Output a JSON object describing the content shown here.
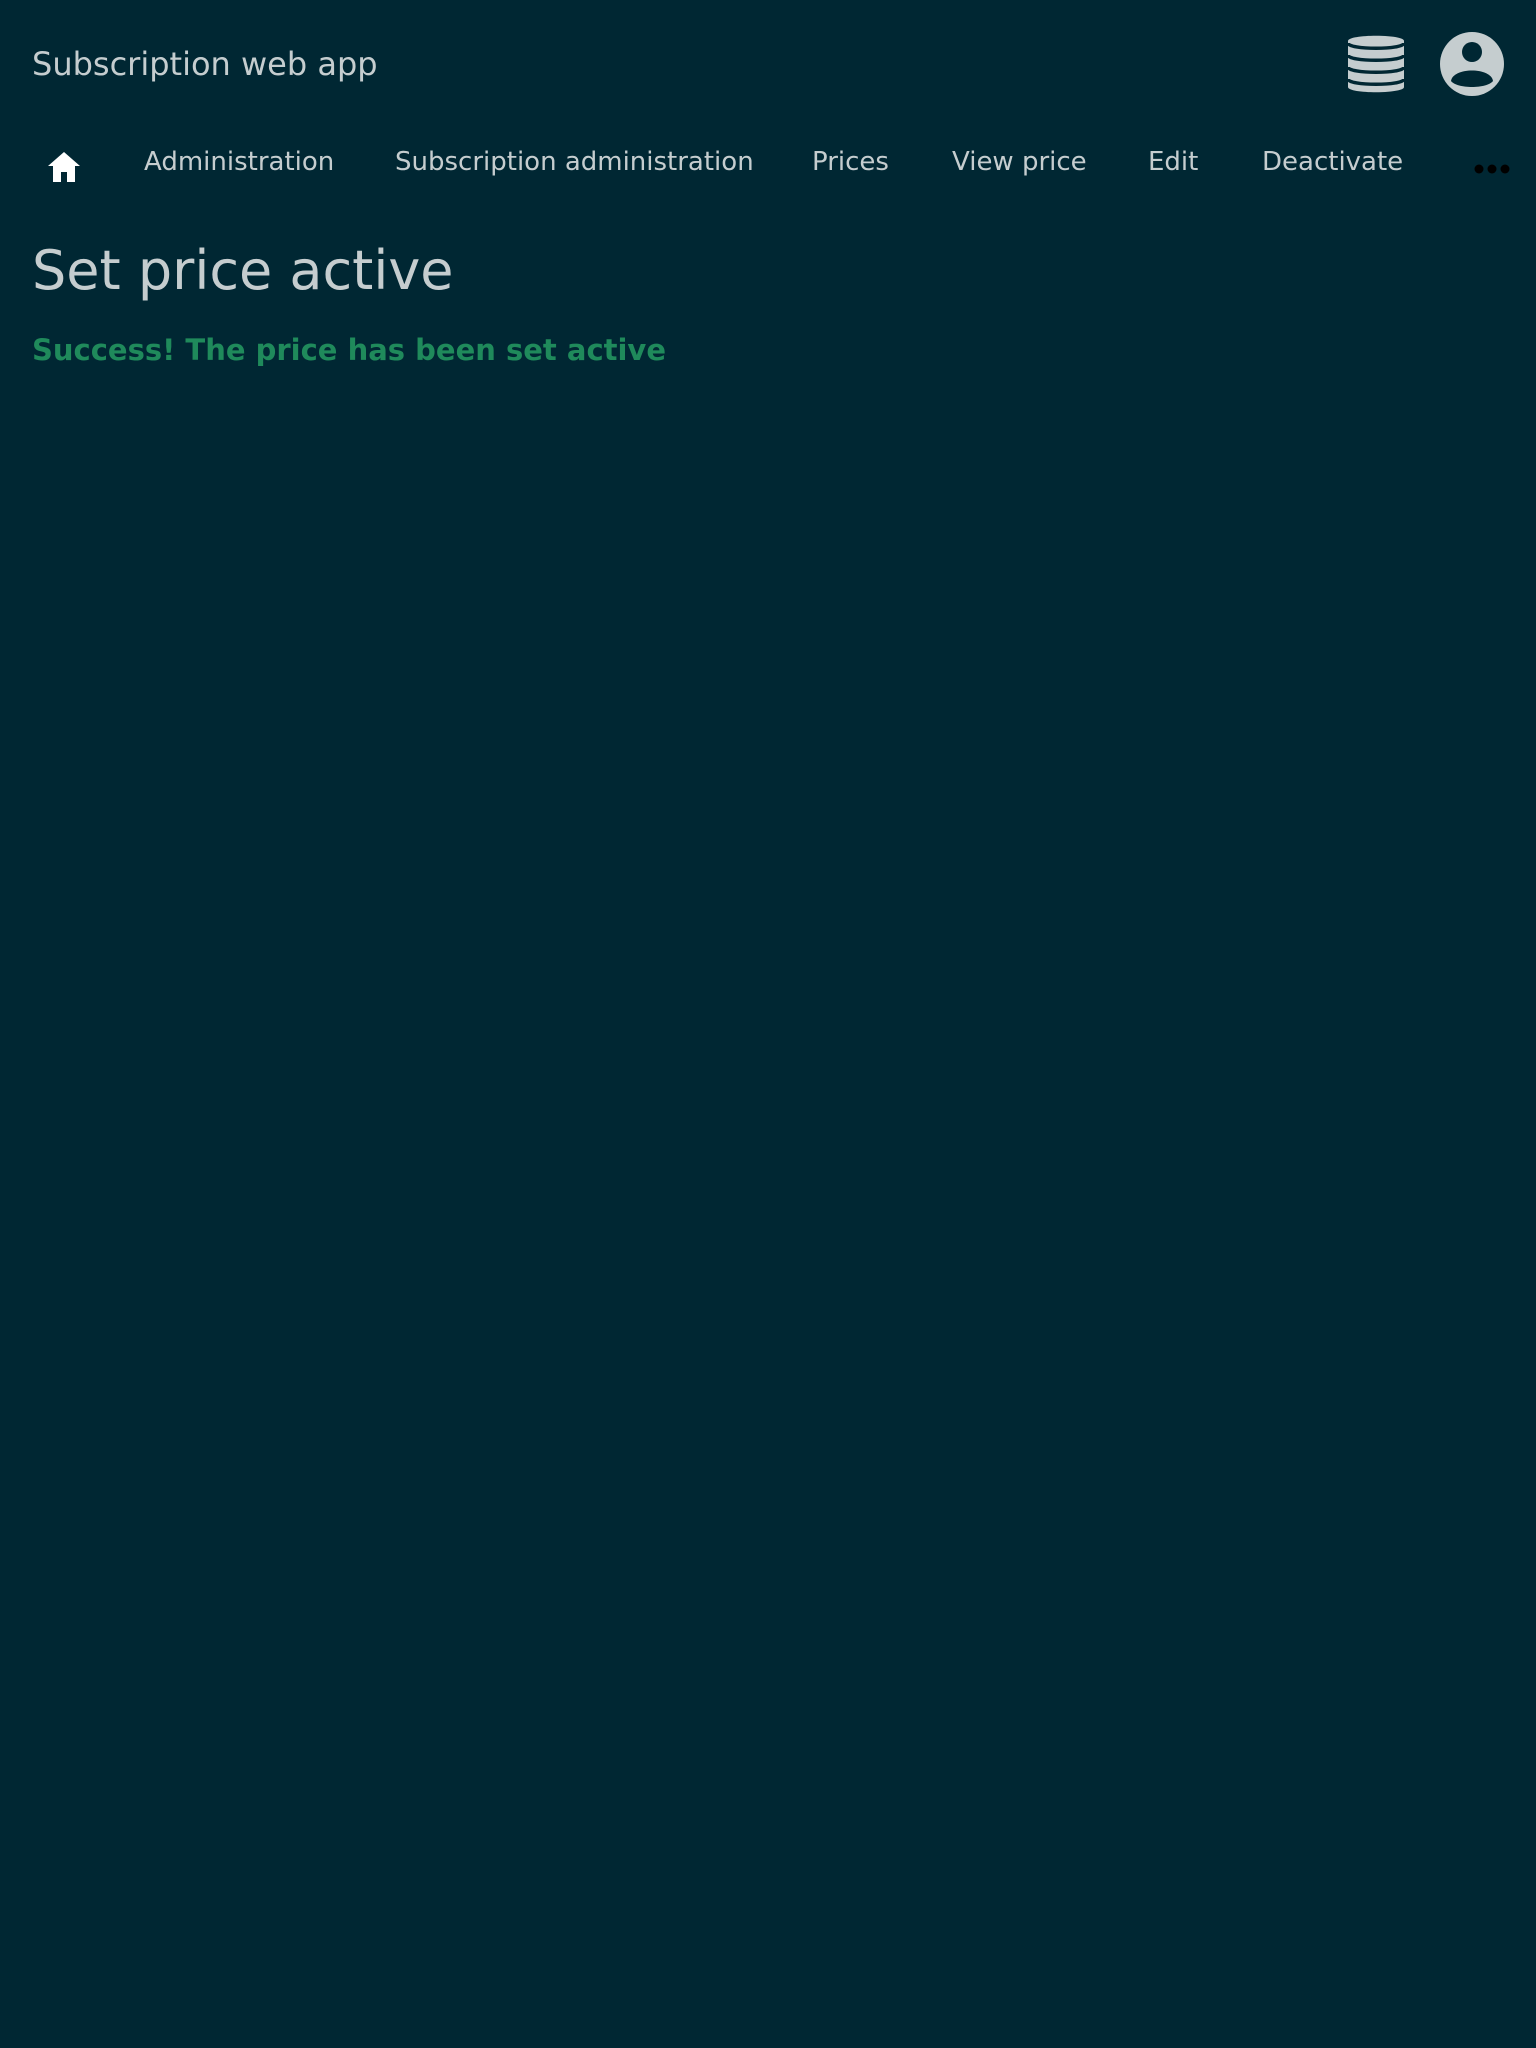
{
  "header": {
    "app_title": "Subscription web app",
    "icons": {
      "database": "database-icon",
      "account": "account-circle-icon"
    }
  },
  "nav": {
    "home_icon": "home-icon",
    "items": [
      {
        "label": "Administration"
      },
      {
        "label": "Subscription administration"
      },
      {
        "label": "Prices"
      },
      {
        "label": "View price"
      },
      {
        "label": "Edit"
      },
      {
        "label": "Deactivate"
      }
    ],
    "more_icon": "more-horizontal-icon"
  },
  "main": {
    "title": "Set price active",
    "success_message": "Success! The price has been set active"
  },
  "colors": {
    "background": "#002733",
    "text": "#c5cdcf",
    "success": "#1f8a5b",
    "home_icon": "#ffffff",
    "more_icon": "#000000"
  }
}
